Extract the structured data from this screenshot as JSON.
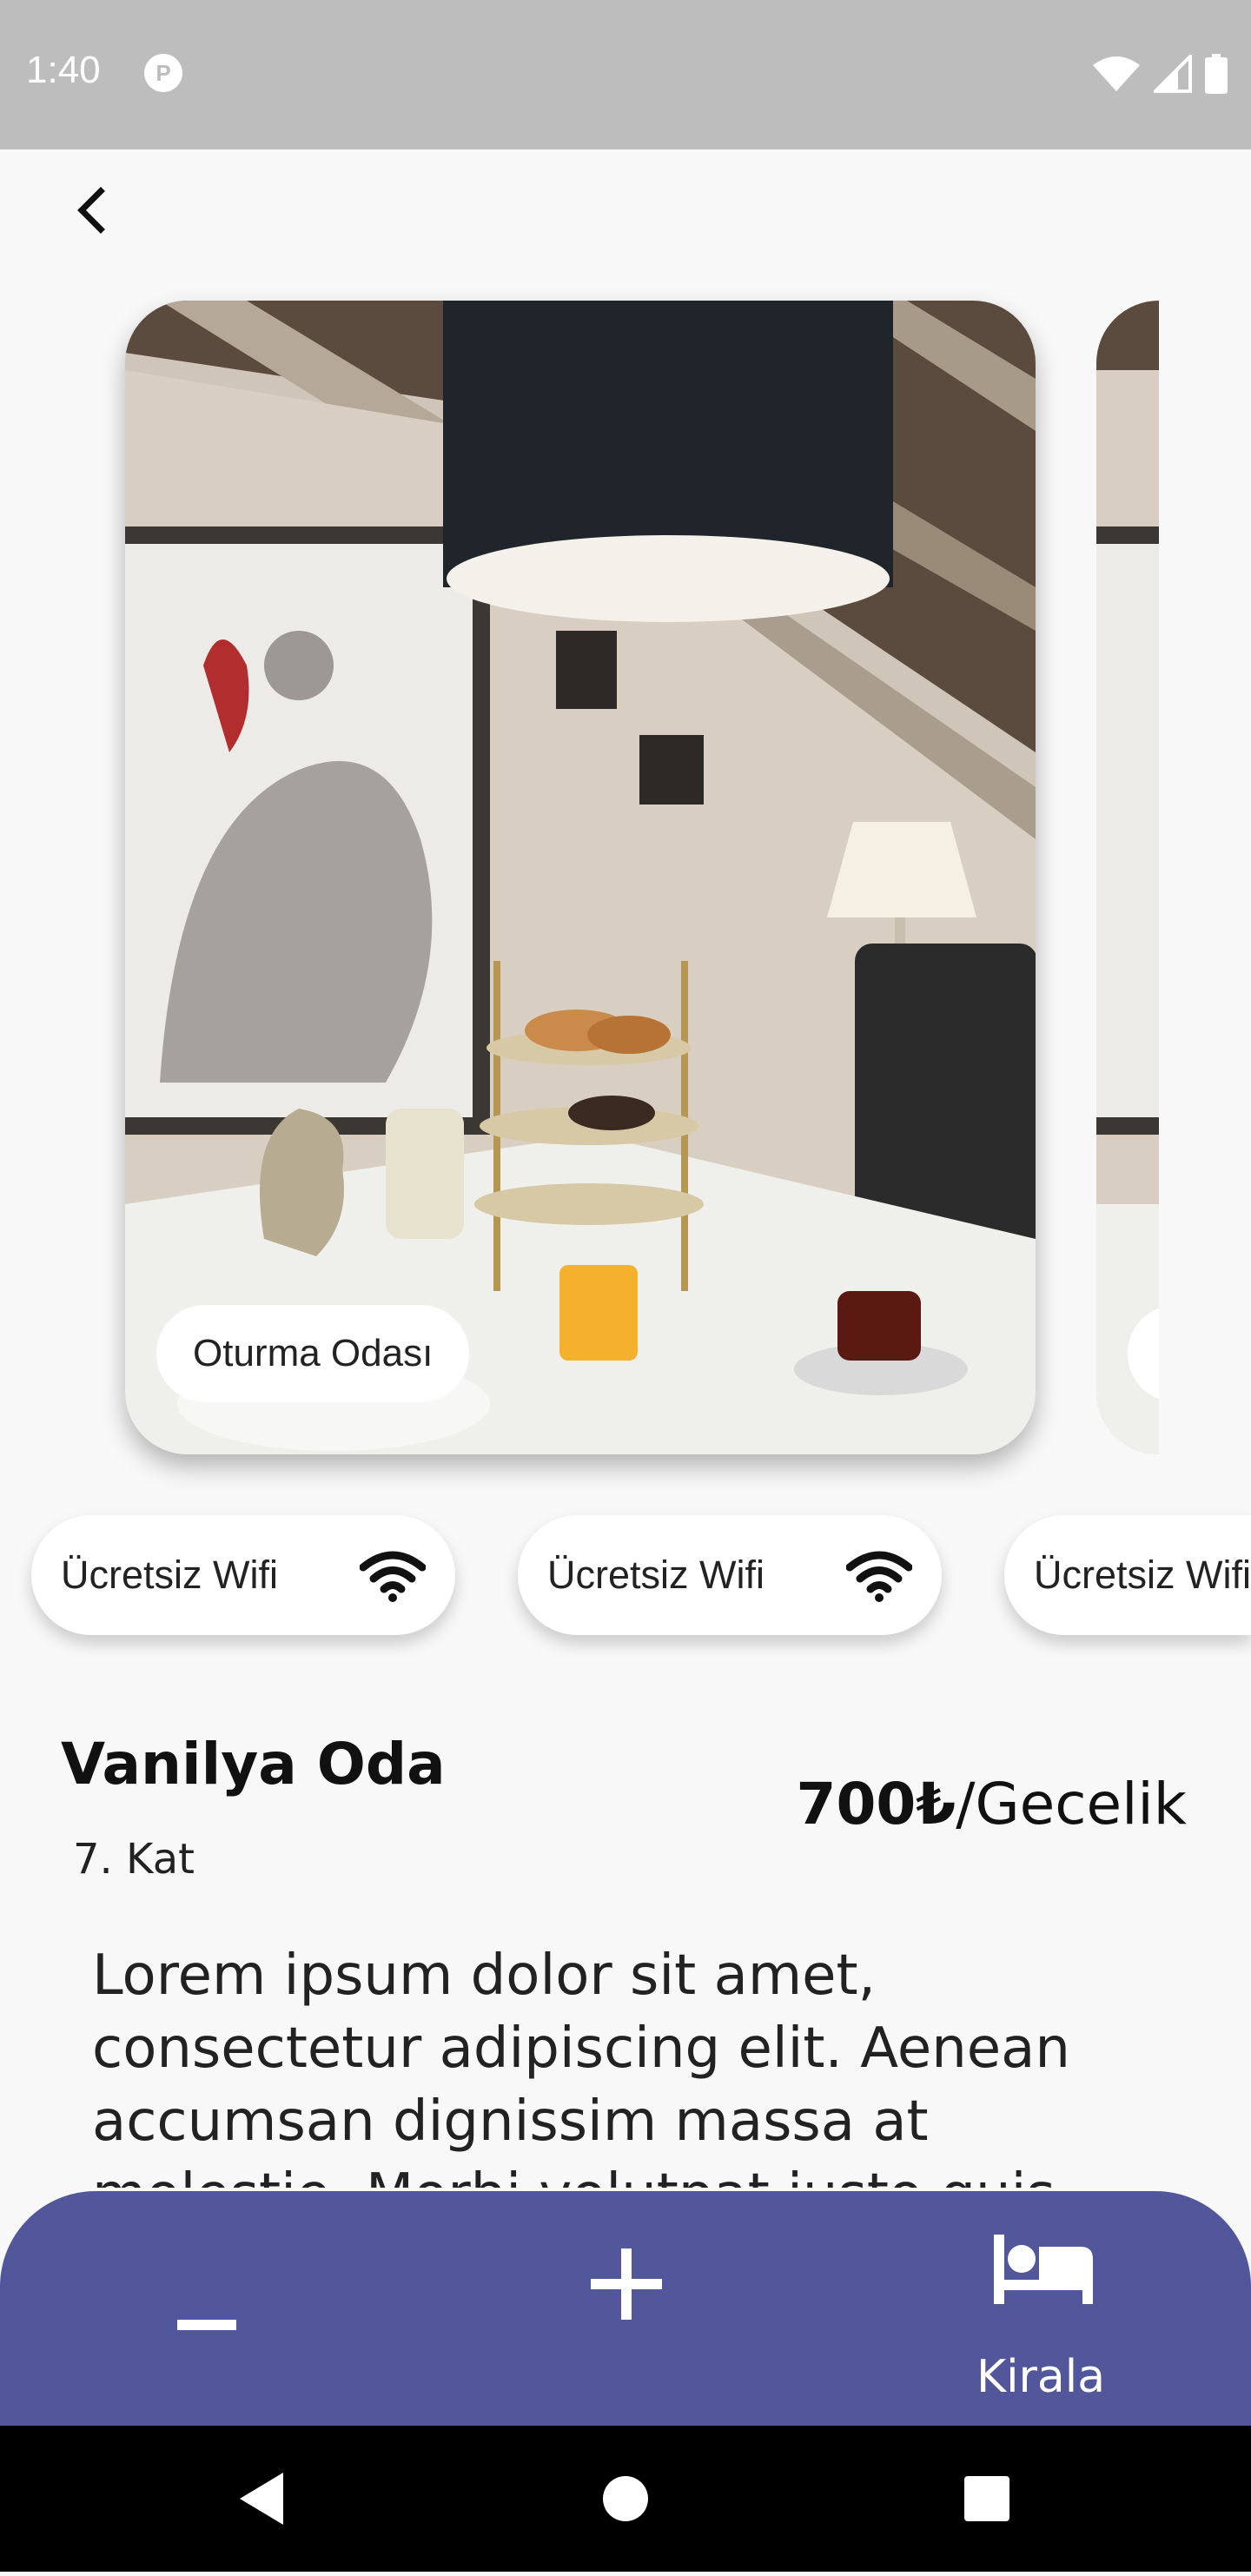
{
  "status_bar": {
    "time": "1:40"
  },
  "room": {
    "photo_label": "Oturma Odası",
    "title": "Vanilya Oda",
    "floor": "7. Kat",
    "price": "700₺",
    "price_unit": "/Gecelik",
    "description": "Lorem ipsum dolor sit amet, consectetur adipiscing elit. Aenean accumsan dignissim massa at molestie. Morbi volutpat justo quis"
  },
  "amenities": [
    {
      "label": "Ücretsiz Wifi",
      "icon": "wifi-icon"
    },
    {
      "label": "Ücretsiz Wifi",
      "icon": "wifi-icon"
    },
    {
      "label": "Ücretsiz Wifi",
      "icon": "wifi-icon"
    }
  ],
  "bottom_actions": {
    "decrease_icon": "minus-icon",
    "increase_icon": "plus-icon",
    "rent_icon": "bed-icon",
    "rent_label": "Kirala"
  },
  "colors": {
    "bottom_bar": "#52579c",
    "status_bar": "#bdbdbd",
    "background": "#f8f8f8"
  }
}
